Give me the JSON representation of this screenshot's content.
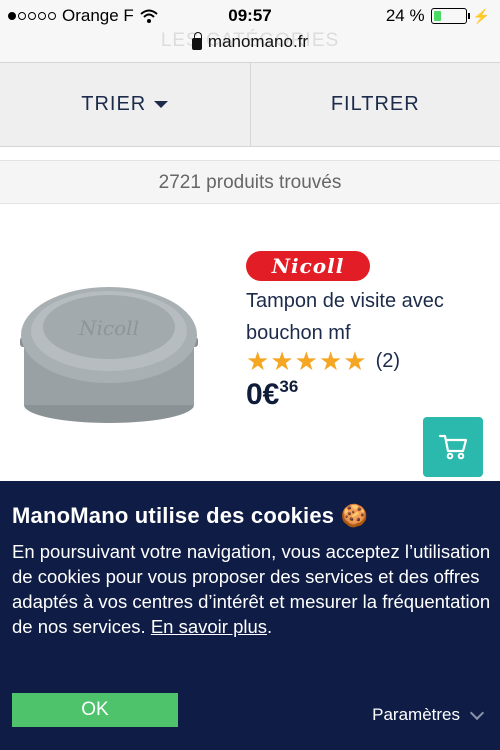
{
  "status_bar": {
    "carrier": "Orange F",
    "time": "09:57",
    "battery": "24 %",
    "battery_level": 0.24
  },
  "browser": {
    "ghost_text": "LES CATÉGORIES",
    "url": "manomano.fr"
  },
  "toolbar": {
    "sort_label": "TRIER",
    "filter_label": "FILTRER"
  },
  "results": {
    "count_text": "2721 produits trouvés"
  },
  "product": {
    "brand": "Nicoll",
    "title": "Tampon de visite avec bouchon mf",
    "rating": 5,
    "review_count": "(2)",
    "price_main": "0€",
    "price_cents": "36"
  },
  "cookie_banner": {
    "title": "ManoMano utilise des cookies 🍪",
    "text": "En poursuivant votre navigation, vous acceptez l’utilisation de cookies pour vous proposer des services et des offres adaptés à vos centres d’intérêt et mesurer la fréquentation de nos services.",
    "link_text": "En savoir plus",
    "ok_label": "OK",
    "settings_label": "Paramètres"
  },
  "colors": {
    "brand_red": "#e31d25",
    "cart_teal": "#2bb8ad",
    "banner_navy": "#0f1d46",
    "ok_green": "#4ec36b",
    "star_orange": "#f5a623"
  }
}
